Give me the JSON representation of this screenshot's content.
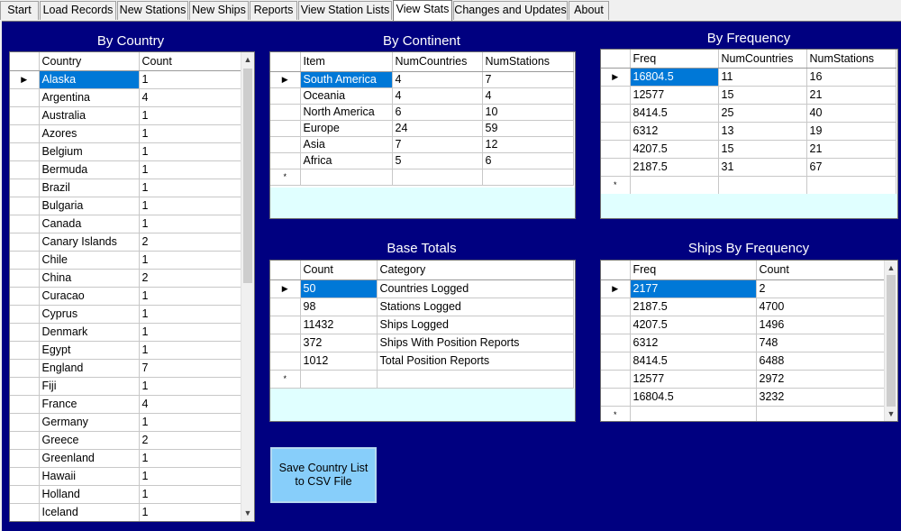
{
  "tabs": [
    "Start",
    "Load Records",
    "New Stations",
    "New Ships",
    "Reports",
    "View Station Lists",
    "View Stats",
    "Changes and Updates",
    "About"
  ],
  "active_tab": "View Stats",
  "by_country": {
    "title": "By Country",
    "columns": [
      "Country",
      "Count"
    ],
    "rows": [
      [
        "Alaska",
        "1"
      ],
      [
        "Argentina",
        "4"
      ],
      [
        "Australia",
        "1"
      ],
      [
        "Azores",
        "1"
      ],
      [
        "Belgium",
        "1"
      ],
      [
        "Bermuda",
        "1"
      ],
      [
        "Brazil",
        "1"
      ],
      [
        "Bulgaria",
        "1"
      ],
      [
        "Canada",
        "1"
      ],
      [
        "Canary Islands",
        "2"
      ],
      [
        "Chile",
        "1"
      ],
      [
        "China",
        "2"
      ],
      [
        "Curacao",
        "1"
      ],
      [
        "Cyprus",
        "1"
      ],
      [
        "Denmark",
        "1"
      ],
      [
        "Egypt",
        "1"
      ],
      [
        "England",
        "7"
      ],
      [
        "Fiji",
        "1"
      ],
      [
        "France",
        "4"
      ],
      [
        "Germany",
        "1"
      ],
      [
        "Greece",
        "2"
      ],
      [
        "Greenland",
        "1"
      ],
      [
        "Hawaii",
        "1"
      ],
      [
        "Holland",
        "1"
      ],
      [
        "Iceland",
        "1"
      ]
    ]
  },
  "by_continent": {
    "title": "By Continent",
    "columns": [
      "Item",
      "NumCountries",
      "NumStations"
    ],
    "rows": [
      [
        "South America",
        "4",
        "7"
      ],
      [
        "Oceania",
        "4",
        "4"
      ],
      [
        "North America",
        "6",
        "10"
      ],
      [
        "Europe",
        "24",
        "59"
      ],
      [
        "Asia",
        "7",
        "12"
      ],
      [
        "Africa",
        "5",
        "6"
      ]
    ]
  },
  "by_frequency": {
    "title": "By Frequency",
    "columns": [
      "Freq",
      "NumCountries",
      "NumStations"
    ],
    "rows": [
      [
        "16804.5",
        "11",
        "16"
      ],
      [
        "12577",
        "15",
        "21"
      ],
      [
        "8414.5",
        "25",
        "40"
      ],
      [
        "6312",
        "13",
        "19"
      ],
      [
        "4207.5",
        "15",
        "21"
      ],
      [
        "2187.5",
        "31",
        "67"
      ]
    ]
  },
  "base_totals": {
    "title": "Base Totals",
    "columns": [
      "Count",
      "Category"
    ],
    "rows": [
      [
        "50",
        "Countries Logged"
      ],
      [
        "98",
        "Stations Logged"
      ],
      [
        "11432",
        "Ships Logged"
      ],
      [
        "372",
        "Ships With Position Reports"
      ],
      [
        "1012",
        "Total Position Reports"
      ]
    ]
  },
  "ships_by_frequency": {
    "title": "Ships By Frequency",
    "columns": [
      "Freq",
      "Count"
    ],
    "rows": [
      [
        "2177",
        "2"
      ],
      [
        "2187.5",
        "4700"
      ],
      [
        "4207.5",
        "1496"
      ],
      [
        "6312",
        "748"
      ],
      [
        "8414.5",
        "6488"
      ],
      [
        "12577",
        "2972"
      ],
      [
        "16804.5",
        "3232"
      ]
    ]
  },
  "save_button": "Save Country List to CSV File",
  "colors": {
    "panel": "#000080",
    "selection": "#0078d7",
    "grid_bottom": "#e0ffff",
    "button": "#87cefa"
  }
}
